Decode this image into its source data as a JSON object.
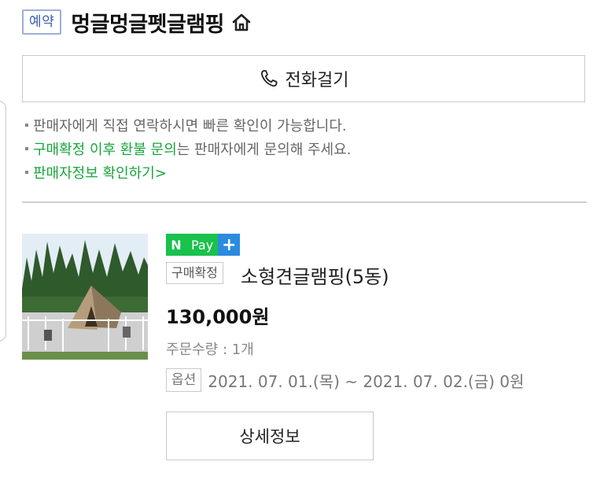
{
  "header": {
    "reservation_badge": "예약",
    "shop_name": "멍글멍글펫글램핑",
    "home_icon": "home-icon"
  },
  "call_button": {
    "label": "전화걸기",
    "icon": "phone-icon"
  },
  "notices": {
    "line1": "판매자에게 직접 연락하시면 빠른 확인이 가능합니다.",
    "line2_highlight": "구매확정 이후 환불 문의",
    "line2_rest": "는 판매자에게 문의해 주세요.",
    "line3_link": "판매자정보 확인하기",
    "line3_chevron": ">"
  },
  "order": {
    "payment_badge": {
      "n": "N",
      "pay": "Pay",
      "plus": "+"
    },
    "status": "구매확정",
    "product_name": "소형견글램핑(5동)",
    "price": "130,000원",
    "quantity": "주문수량 : 1개",
    "option_label": "옵션",
    "option_value": "2021. 07. 01.(목) ~ 2021. 07. 02.(금) 0원",
    "detail_button": "상세정보"
  },
  "colors": {
    "accent_green": "#19a53c",
    "npay_green": "#19c14d",
    "npay_blue": "#2a8be0",
    "badge_blue": "#3e5fa8"
  }
}
